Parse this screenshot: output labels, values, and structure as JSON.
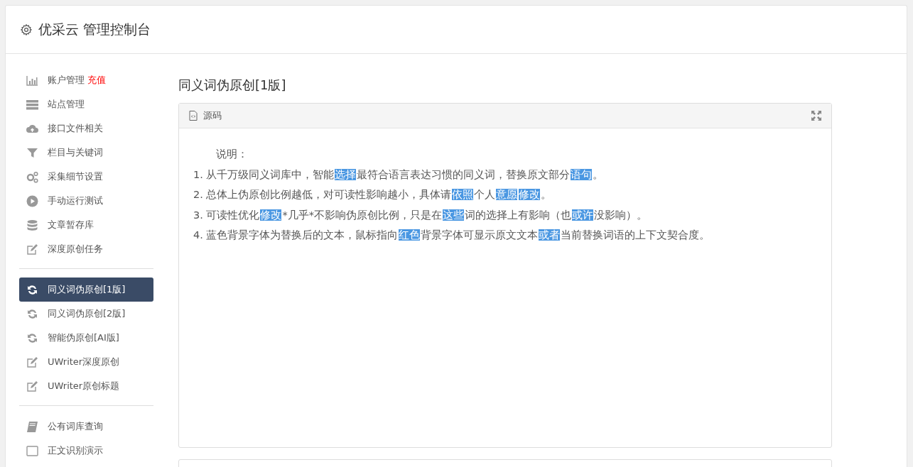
{
  "header": {
    "title": "优采云 管理控制台"
  },
  "sidebar": {
    "groups": [
      {
        "items": [
          {
            "label": "账户管理",
            "badge": "充值",
            "selected": false
          },
          {
            "label": "站点管理",
            "selected": false
          },
          {
            "label": "接口文件相关",
            "selected": false
          },
          {
            "label": "栏目与关键词",
            "selected": false
          },
          {
            "label": "采集细节设置",
            "selected": false
          },
          {
            "label": "手动运行测试",
            "selected": false
          },
          {
            "label": "文章暂存库",
            "selected": false
          },
          {
            "label": "深度原创任务",
            "selected": false
          }
        ]
      },
      {
        "items": [
          {
            "label": "同义词伪原创[1版]",
            "selected": true
          },
          {
            "label": "同义词伪原创[2版]",
            "selected": false
          },
          {
            "label": "智能伪原创[AI版]",
            "selected": false
          },
          {
            "label": "UWriter深度原创",
            "selected": false
          },
          {
            "label": "UWriter原创标题",
            "selected": false
          }
        ]
      },
      {
        "items": [
          {
            "label": "公有词库查询",
            "selected": false
          },
          {
            "label": "正文识别演示",
            "selected": false
          }
        ]
      }
    ]
  },
  "main": {
    "title": "同义词伪原创[1版]",
    "panel": {
      "title": "源码",
      "heading": "说明：",
      "lines": [
        [
          {
            "text": "1. 从千万级同义词库中，智能",
            "highlighted": false
          },
          {
            "text": "选择",
            "highlighted": true
          },
          {
            "text": "最符合语言表达习惯的同义词，替换原文部分",
            "highlighted": false
          },
          {
            "text": "语句",
            "highlighted": true
          },
          {
            "text": "。",
            "highlighted": false
          }
        ],
        [
          {
            "text": "2. 总体上伪原创比例越低，对可读性影响越小，具体请",
            "highlighted": false
          },
          {
            "text": "依照",
            "highlighted": true
          },
          {
            "text": "个人",
            "highlighted": false
          },
          {
            "text": "意愿",
            "highlighted": true
          },
          {
            "text": "修改",
            "highlighted": true
          },
          {
            "text": "。",
            "highlighted": false
          }
        ],
        [
          {
            "text": "3. 可读性优化",
            "highlighted": false
          },
          {
            "text": "修改",
            "highlighted": true
          },
          {
            "text": "*几乎*不影响伪原创比例，只是在",
            "highlighted": false
          },
          {
            "text": "这些",
            "highlighted": true
          },
          {
            "text": "词的选择上有影响（也",
            "highlighted": false
          },
          {
            "text": "或许",
            "highlighted": true
          },
          {
            "text": "没影响）。",
            "highlighted": false
          }
        ],
        [
          {
            "text": "4. 蓝色背景字体为替换后的文本，鼠标指向",
            "highlighted": false
          },
          {
            "text": "红色",
            "highlighted": true
          },
          {
            "text": "背景字体可显示原文文本",
            "highlighted": false
          },
          {
            "text": "或者",
            "highlighted": true
          },
          {
            "text": "当前替换词语的上下文契合度。",
            "highlighted": false
          }
        ]
      ]
    }
  }
}
